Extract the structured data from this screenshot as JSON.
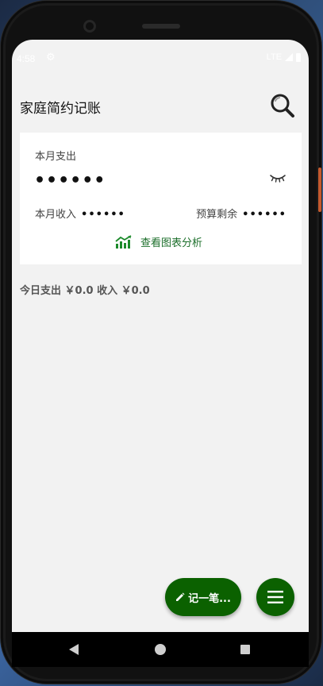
{
  "status_bar": {
    "time": "4:58",
    "network": "LTE"
  },
  "app_bar": {
    "title": "家庭简约记账",
    "search_icon": "search-icon"
  },
  "summary_card": {
    "expense_label": "本月支出",
    "expense_value": "••••••",
    "income_label": "本月收入",
    "income_value": "••••••",
    "budget_label": "预算剩余",
    "budget_value": "••••••",
    "visibility_icon": "eye-closed-icon",
    "chart_link_label": "查看图表分析",
    "chart_link_icon": "trending-chart-icon"
  },
  "today": {
    "summary": "今日支出 ￥0.0  收入 ￥0.0"
  },
  "fabs": {
    "record_label": "记一笔...",
    "record_icon": "pencil-icon",
    "menu_icon": "menu-icon"
  },
  "colors": {
    "accent": "#0b6100",
    "link": "#1b6e2a",
    "background": "#f2f2f2"
  }
}
